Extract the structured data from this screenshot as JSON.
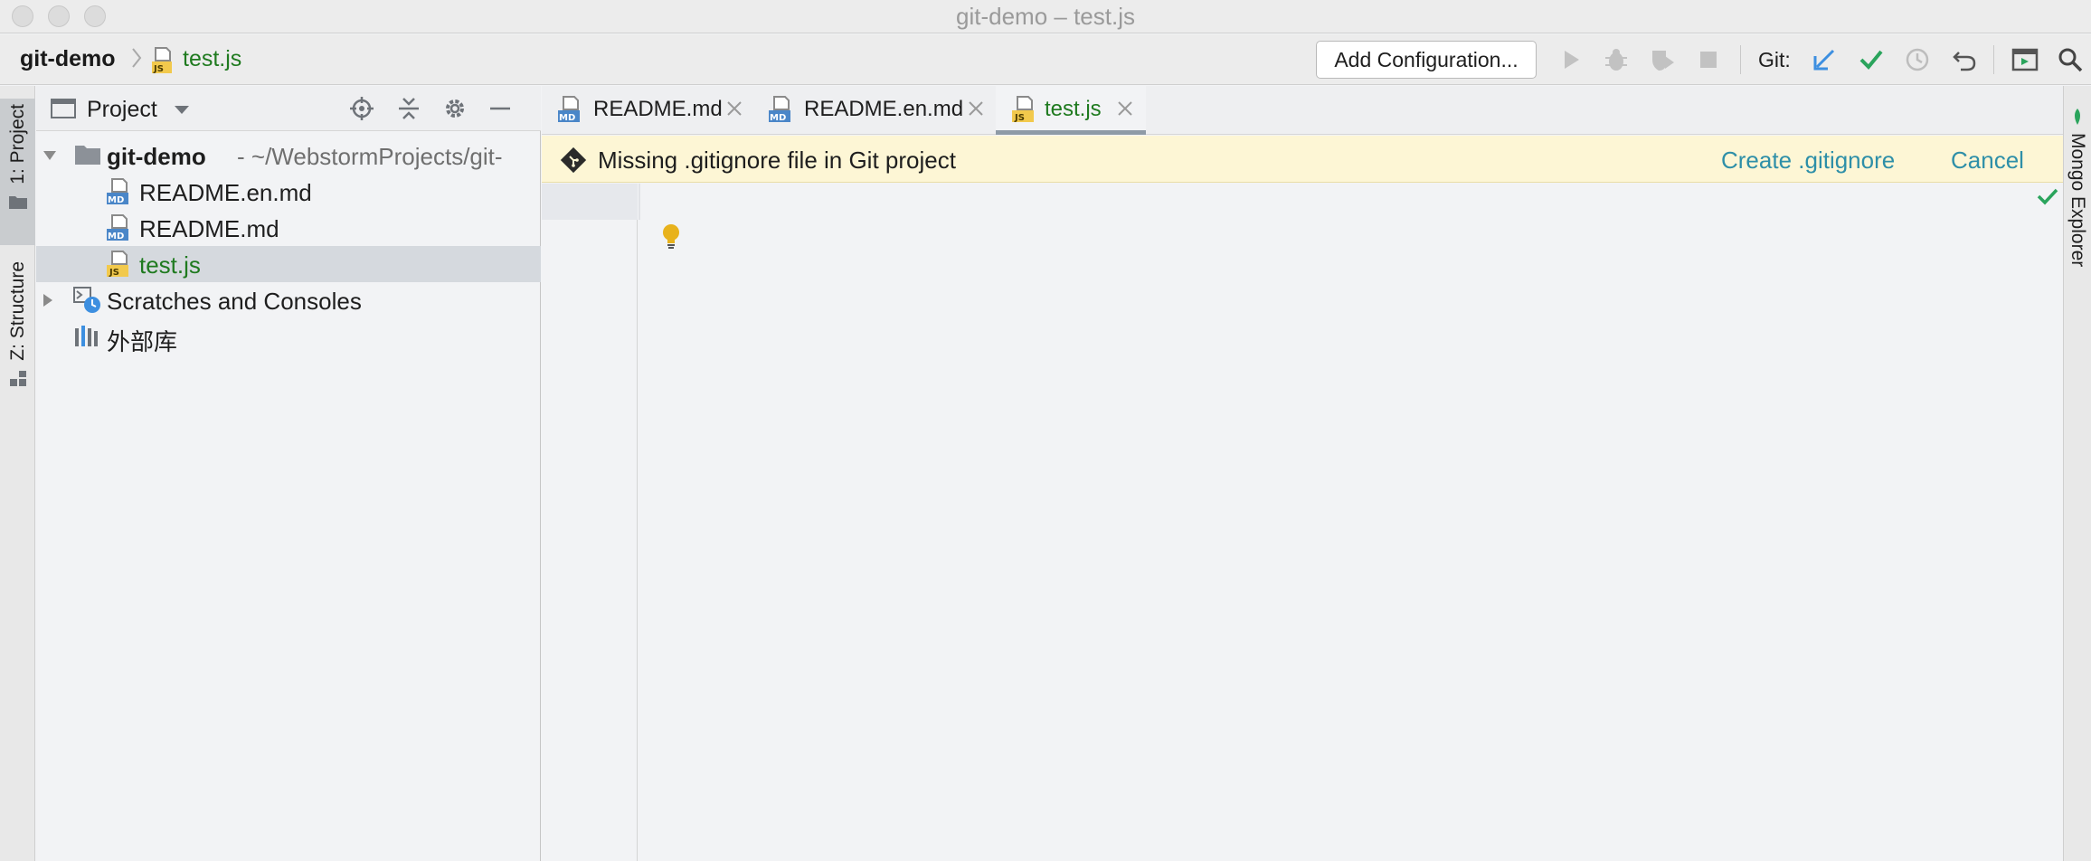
{
  "window": {
    "title": "git-demo – test.js"
  },
  "navbar": {
    "project": "git-demo",
    "file": "test.js",
    "add_configuration": "Add Configuration...",
    "git_label": "Git:"
  },
  "left_stripe": {
    "project_tab": "1: Project",
    "structure_tab": "Z: Structure"
  },
  "right_stripe": {
    "mongo_tab": "Mongo Explorer"
  },
  "project_panel": {
    "title": "Project",
    "root_name": "git-demo",
    "root_path": "- ~/WebstormProjects/git-",
    "files": [
      {
        "name": "README.en.md",
        "type": "MD"
      },
      {
        "name": "README.md",
        "type": "MD"
      },
      {
        "name": "test.js",
        "type": "JS"
      }
    ],
    "scratches": "Scratches and Consoles",
    "external_libraries": "外部库"
  },
  "editor": {
    "tabs": [
      {
        "label": "README.md",
        "type": "MD"
      },
      {
        "label": "README.en.md",
        "type": "MD"
      },
      {
        "label": "test.js",
        "type": "JS",
        "active": true
      }
    ],
    "banner": {
      "message": "Missing .gitignore file in Git project",
      "create": "Create .gitignore",
      "cancel": "Cancel"
    }
  },
  "colors": {
    "accent_green": "#1f7a1f",
    "link": "#2e8fa8",
    "banner_bg": "#fdf6d5",
    "git_update": "#3d8fe0",
    "git_commit": "#2aa45c"
  },
  "icons": [
    "search-icon",
    "run-icon",
    "debug-icon",
    "coverage-icon",
    "stop-icon",
    "git-update-icon",
    "git-commit-icon",
    "git-history-icon",
    "git-rollback-icon",
    "run-anything-icon",
    "locate-icon",
    "collapse-all-icon",
    "gear-icon",
    "hide-icon",
    "lightbulb-icon",
    "inspection-ok-icon",
    "mongo-leaf-icon"
  ]
}
